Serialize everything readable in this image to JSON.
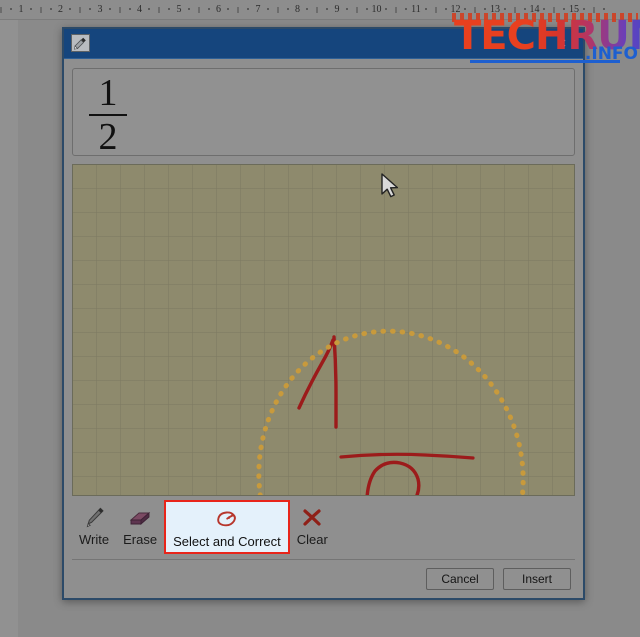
{
  "ruler": {
    "name": "horizontal-ruler",
    "marks": [
      1,
      2,
      3,
      4,
      5,
      6,
      7,
      8,
      9,
      10,
      11,
      12,
      13,
      14,
      15
    ]
  },
  "watermark": {
    "main": "TECHRUM",
    "sub": ".INFO"
  },
  "dialog": {
    "title": "",
    "icon": "ink-pen-icon",
    "close_label": "×",
    "preview": {
      "numerator": "1",
      "denominator": "2"
    },
    "canvas": {
      "name": "ink-writing-canvas",
      "background_color": "#8e8a6d",
      "grid_color": "#7d7a62",
      "ink_color": "#9c1b1b",
      "lasso_color": "#c89a3c",
      "written_expression": "1/2"
    },
    "tools": [
      {
        "id": "write",
        "label": "Write",
        "icon": "pen-icon",
        "active": false
      },
      {
        "id": "erase",
        "label": "Erase",
        "icon": "eraser-icon",
        "active": false
      },
      {
        "id": "select-and-correct",
        "label": "Select and Correct",
        "icon": "lasso-icon",
        "active": true
      },
      {
        "id": "clear",
        "label": "Clear",
        "icon": "x-mark-icon",
        "active": false
      }
    ],
    "footer": {
      "cancel_label": "Cancel",
      "insert_label": "Insert"
    }
  },
  "colors": {
    "titlebar": "#15457d",
    "dialog_border": "#2c4a68",
    "highlight_border": "#e8251a",
    "highlight_fill": "#e4f1fb",
    "ink": "#9c1b1b",
    "lasso": "#c89a3c"
  }
}
